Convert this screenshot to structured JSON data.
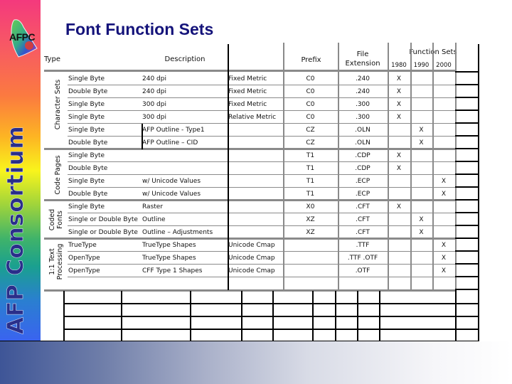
{
  "slide": {
    "title": "Font Function Sets",
    "logo_text": "AFPC",
    "band_text": "AFP Consortium"
  },
  "table": {
    "headers": {
      "type": "Type",
      "description": "Description",
      "prefix": "Prefix",
      "file_extension_line1": "File",
      "file_extension_line2": "Extension",
      "function_sets": "Function Sets",
      "years": [
        "1980",
        "1990",
        "2000"
      ]
    },
    "groups": [
      {
        "label": "Character Sets"
      },
      {
        "label": "Code Pages"
      },
      {
        "label_line1": "Coded",
        "label_line2": "Fonts"
      },
      {
        "label_line1": "1:1 Text",
        "label_line2": "Processing"
      }
    ],
    "rows": [
      {
        "type": "Single Byte",
        "description": "240 dpi",
        "metric": "Fixed Metric",
        "prefix": "C0",
        "ext": ".240",
        "y1980": "X",
        "y1990": "",
        "y2000": ""
      },
      {
        "type": "Double Byte",
        "description": "240 dpi",
        "metric": "Fixed Metric",
        "prefix": "C0",
        "ext": ".240",
        "y1980": "X",
        "y1990": "",
        "y2000": ""
      },
      {
        "type": "Single Byte",
        "description": "300 dpi",
        "metric": "Fixed Metric",
        "prefix": "C0",
        "ext": ".300",
        "y1980": "X",
        "y1990": "",
        "y2000": ""
      },
      {
        "type": "Single Byte",
        "description": "300 dpi",
        "metric": "Relative Metric",
        "prefix": "C0",
        "ext": ".300",
        "y1980": "X",
        "y1990": "",
        "y2000": ""
      },
      {
        "type": "Single Byte",
        "description": "AFP Outline - Type1",
        "metric": "",
        "prefix": "CZ",
        "ext": ".OLN",
        "y1980": "",
        "y1990": "X",
        "y2000": ""
      },
      {
        "type": "Double Byte",
        "description": "AFP Outline – CID",
        "metric": "",
        "prefix": "CZ",
        "ext": ".OLN",
        "y1980": "",
        "y1990": "X",
        "y2000": ""
      },
      {
        "type": "Single Byte",
        "description": "",
        "metric": "",
        "prefix": "T1",
        "ext": ".CDP",
        "y1980": "X",
        "y1990": "",
        "y2000": ""
      },
      {
        "type": "Double Byte",
        "description": "",
        "metric": "",
        "prefix": "T1",
        "ext": ".CDP",
        "y1980": "X",
        "y1990": "",
        "y2000": ""
      },
      {
        "type": "Single Byte",
        "description": "w/ Unicode Values",
        "metric": "",
        "prefix": "T1",
        "ext": ".ECP",
        "y1980": "",
        "y1990": "",
        "y2000": "X"
      },
      {
        "type": "Double Byte",
        "description": "w/ Unicode Values",
        "metric": "",
        "prefix": "T1",
        "ext": ".ECP",
        "y1980": "",
        "y1990": "",
        "y2000": "X"
      },
      {
        "type": "Single Byte",
        "description": "Raster",
        "metric": "",
        "prefix": "X0",
        "ext": ".CFT",
        "y1980": "X",
        "y1990": "",
        "y2000": ""
      },
      {
        "type": "Single or Double Byte",
        "description": "Outline",
        "metric": "",
        "prefix": "XZ",
        "ext": ".CFT",
        "y1980": "",
        "y1990": "X",
        "y2000": ""
      },
      {
        "type": "Single or Double Byte",
        "description": "Outline – Adjustments",
        "metric": "",
        "prefix": "XZ",
        "ext": ".CFT",
        "y1980": "",
        "y1990": "X",
        "y2000": ""
      },
      {
        "type": "TrueType",
        "description": "TrueType Shapes",
        "metric": "Unicode Cmap",
        "prefix": "",
        "ext": ".TTF",
        "y1980": "",
        "y1990": "",
        "y2000": "X"
      },
      {
        "type": "OpenType",
        "description": "TrueType Shapes",
        "metric": "Unicode Cmap",
        "prefix": "",
        "ext": ".TTF .OTF",
        "y1980": "",
        "y1990": "",
        "y2000": "X"
      },
      {
        "type": "OpenType",
        "description": "CFF Type 1 Shapes",
        "metric": "Unicode Cmap",
        "prefix": "",
        "ext": ".OTF",
        "y1980": "",
        "y1990": "",
        "y2000": "X"
      }
    ]
  }
}
